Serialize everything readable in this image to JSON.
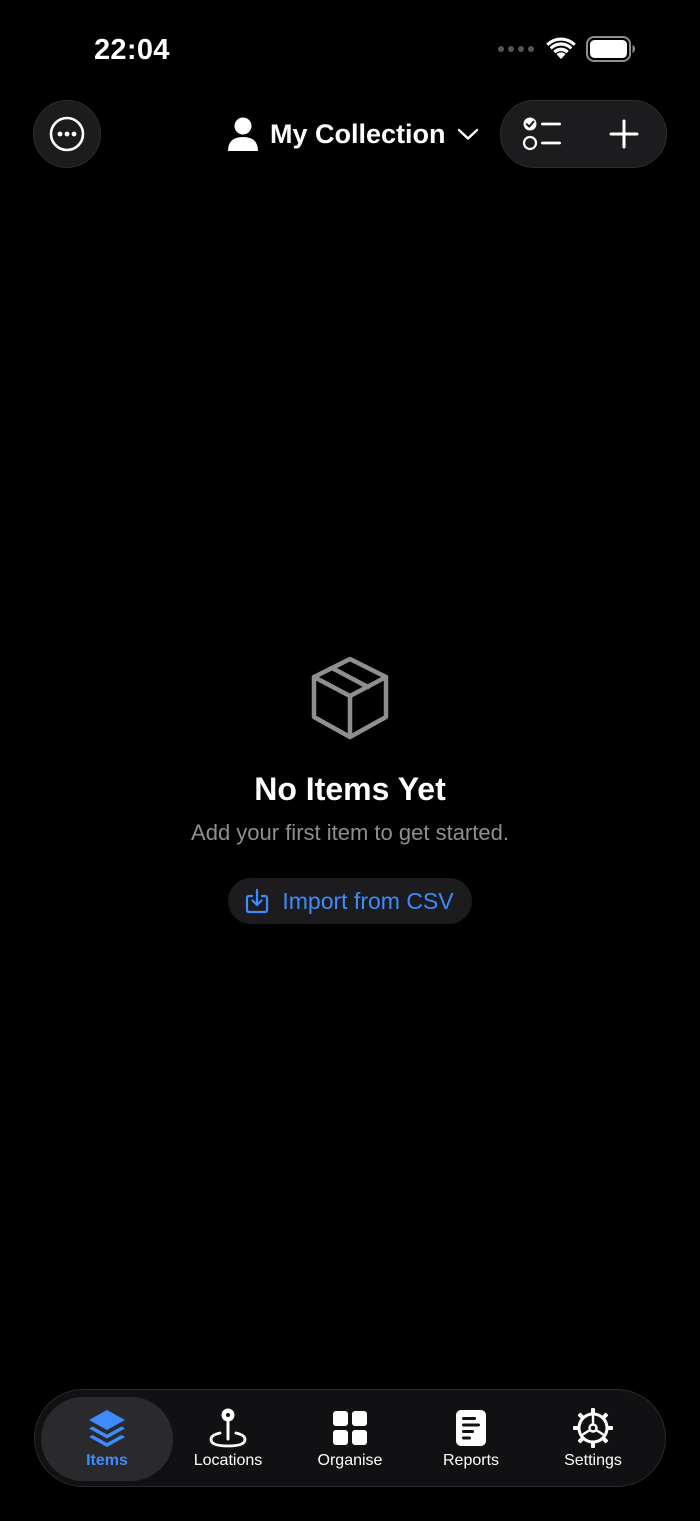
{
  "status_bar": {
    "time": "22:04",
    "icons": [
      "cellular-dots-icon",
      "wifi-icon",
      "battery-icon"
    ]
  },
  "header": {
    "more_icon": "ellipsis-circle-icon",
    "collection_icon": "person-icon",
    "collection_title": "My Collection",
    "collection_chevron": "chevron-down-icon",
    "actions": [
      "checklist-icon",
      "plus-icon"
    ]
  },
  "empty_state": {
    "icon": "box-icon",
    "title": "No Items Yet",
    "subtitle": "Add your first item to get started.",
    "import_label": "Import from CSV",
    "import_icon": "import-icon"
  },
  "tab_bar": {
    "active_tab": "Items",
    "tabs": [
      {
        "label": "Items",
        "icon": "layers-icon"
      },
      {
        "label": "Locations",
        "icon": "location-pin-icon"
      },
      {
        "label": "Organise",
        "icon": "grid-icon"
      },
      {
        "label": "Reports",
        "icon": "report-icon"
      },
      {
        "label": "Settings",
        "icon": "gear-icon"
      }
    ]
  },
  "colors": {
    "background": "#000000",
    "accent": "#3d8bfd",
    "surface": "#1c1c1e",
    "secondary_text": "#8e8e93"
  }
}
